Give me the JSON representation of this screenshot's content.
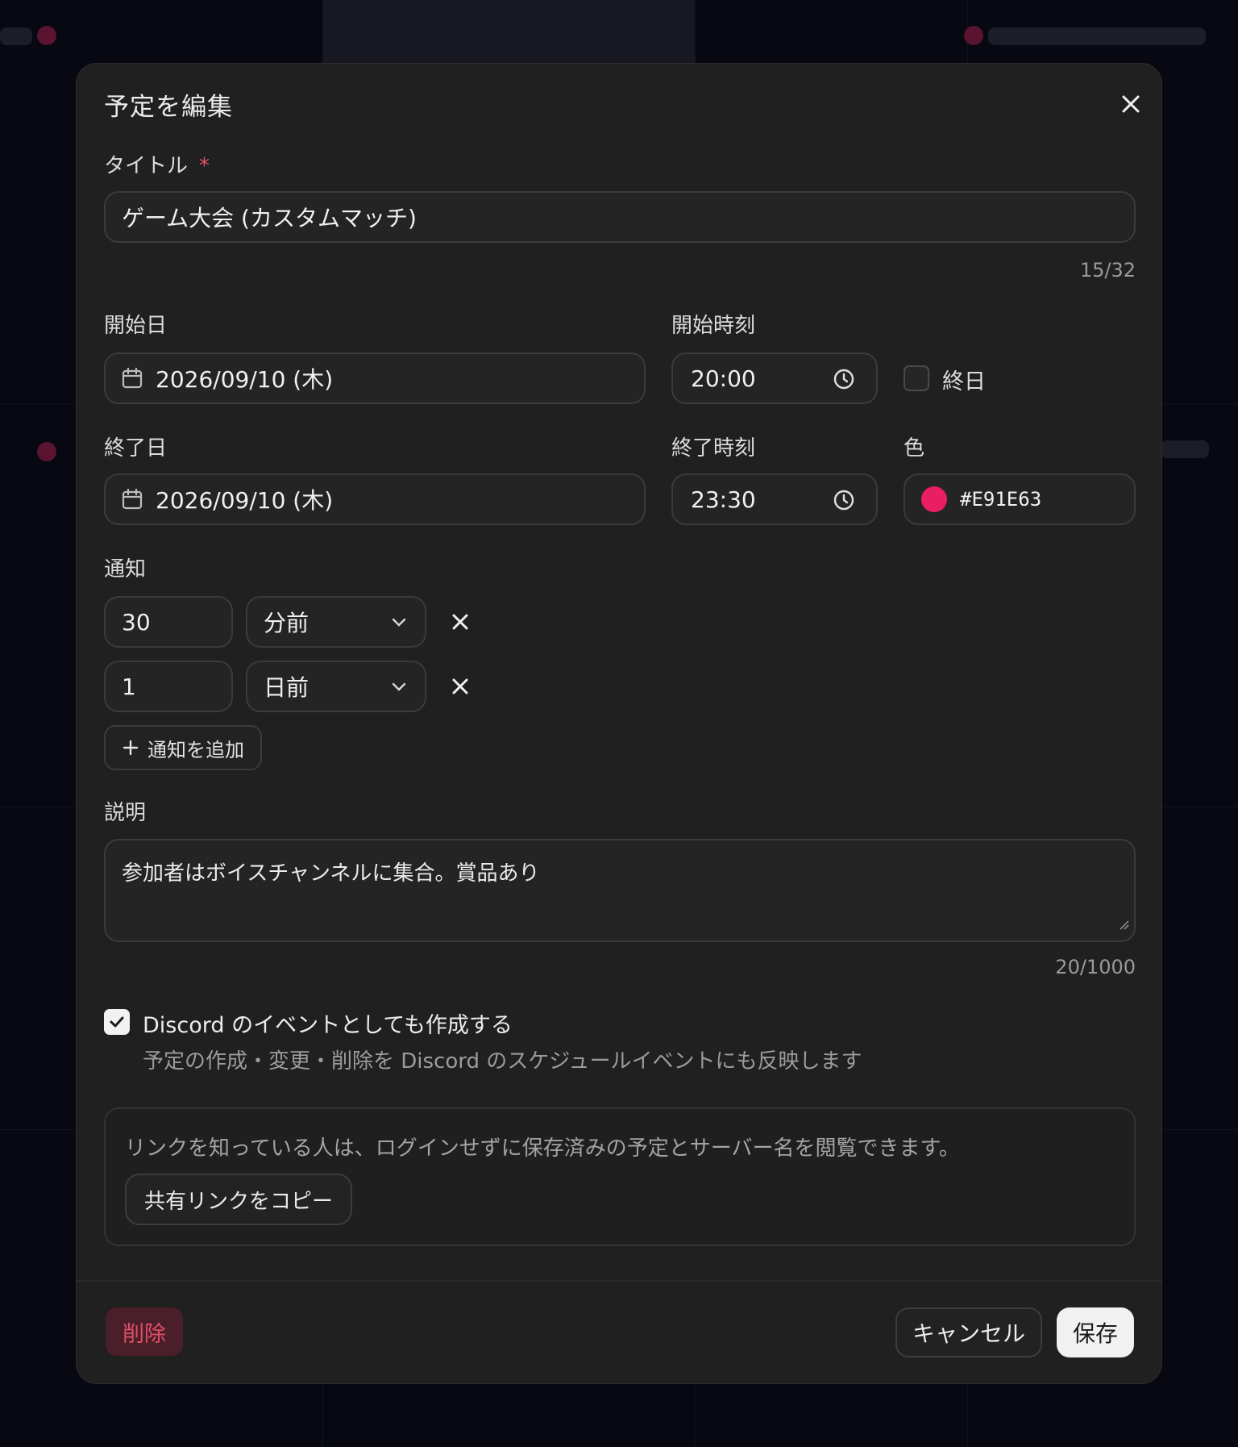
{
  "modal": {
    "title": "予定を編集",
    "close_icon": "close-icon"
  },
  "title_field": {
    "label": "タイトル",
    "required_mark": "*",
    "value": "ゲーム大会 (カスタムマッチ)",
    "counter": "15/32"
  },
  "start": {
    "date_label": "開始日",
    "date_value": "2026/09/10 (木)",
    "time_label": "開始時刻",
    "time_value": "20:00",
    "all_day_label": "終日",
    "all_day_checked": false
  },
  "end": {
    "date_label": "終了日",
    "date_value": "2026/09/10 (木)",
    "time_label": "終了時刻",
    "time_value": "23:30"
  },
  "color": {
    "label": "色",
    "value": "#E91E63"
  },
  "notifications": {
    "label": "通知",
    "items": [
      {
        "amount": "30",
        "unit": "分前"
      },
      {
        "amount": "1",
        "unit": "日前"
      }
    ],
    "add_label": "通知を追加"
  },
  "description": {
    "label": "説明",
    "value": "参加者はボイスチャンネルに集合。賞品あり",
    "counter": "20/1000"
  },
  "discord": {
    "checked": true,
    "label": "Discord のイベントとしても作成する",
    "help": "予定の作成・変更・削除を Discord のスケジュールイベントにも反映します"
  },
  "share": {
    "text": "リンクを知っている人は、ログインせずに保存済みの予定とサーバー名を閲覧できます。",
    "button": "共有リンクをコピー"
  },
  "footer": {
    "delete": "削除",
    "cancel": "キャンセル",
    "save": "保存"
  }
}
